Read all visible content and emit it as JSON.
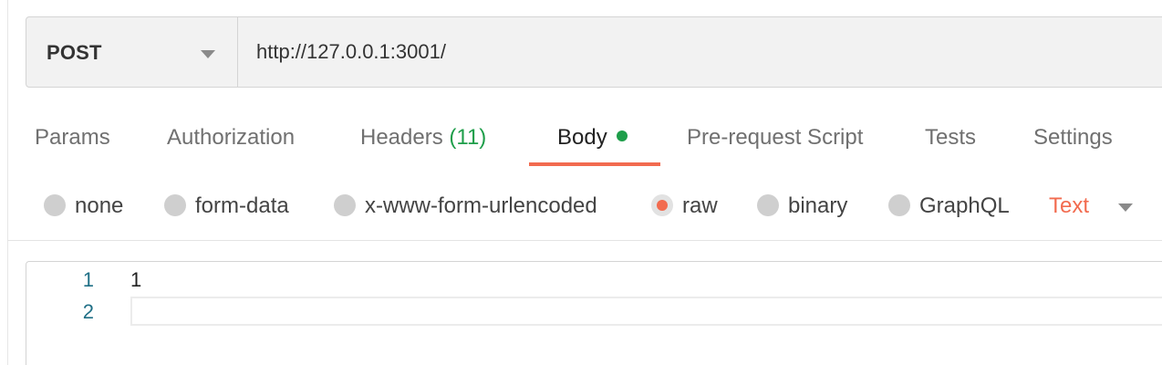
{
  "request": {
    "method": "POST",
    "url": "http://127.0.0.1:3001/"
  },
  "tabs": [
    {
      "label": "Params"
    },
    {
      "label": "Authorization"
    },
    {
      "label": "Headers",
      "count": "(11)"
    },
    {
      "label": "Body",
      "active": true
    },
    {
      "label": "Pre-request Script"
    },
    {
      "label": "Tests"
    },
    {
      "label": "Settings"
    }
  ],
  "body_types": [
    {
      "label": "none"
    },
    {
      "label": "form-data"
    },
    {
      "label": "x-www-form-urlencoded"
    },
    {
      "label": "raw",
      "selected": true
    },
    {
      "label": "binary"
    },
    {
      "label": "GraphQL"
    }
  ],
  "raw_format": "Text",
  "editor": {
    "lines": [
      {
        "number": "1",
        "text": "1"
      },
      {
        "number": "2",
        "text": ""
      }
    ]
  },
  "colors": {
    "accent": "#f26b4f",
    "success": "#1e9e4a",
    "line_number": "#1f6f86"
  },
  "icons": {
    "method_dropdown": "chevron-down-icon",
    "format_dropdown": "chevron-down-icon",
    "body_indicator": "green-dot-icon"
  }
}
